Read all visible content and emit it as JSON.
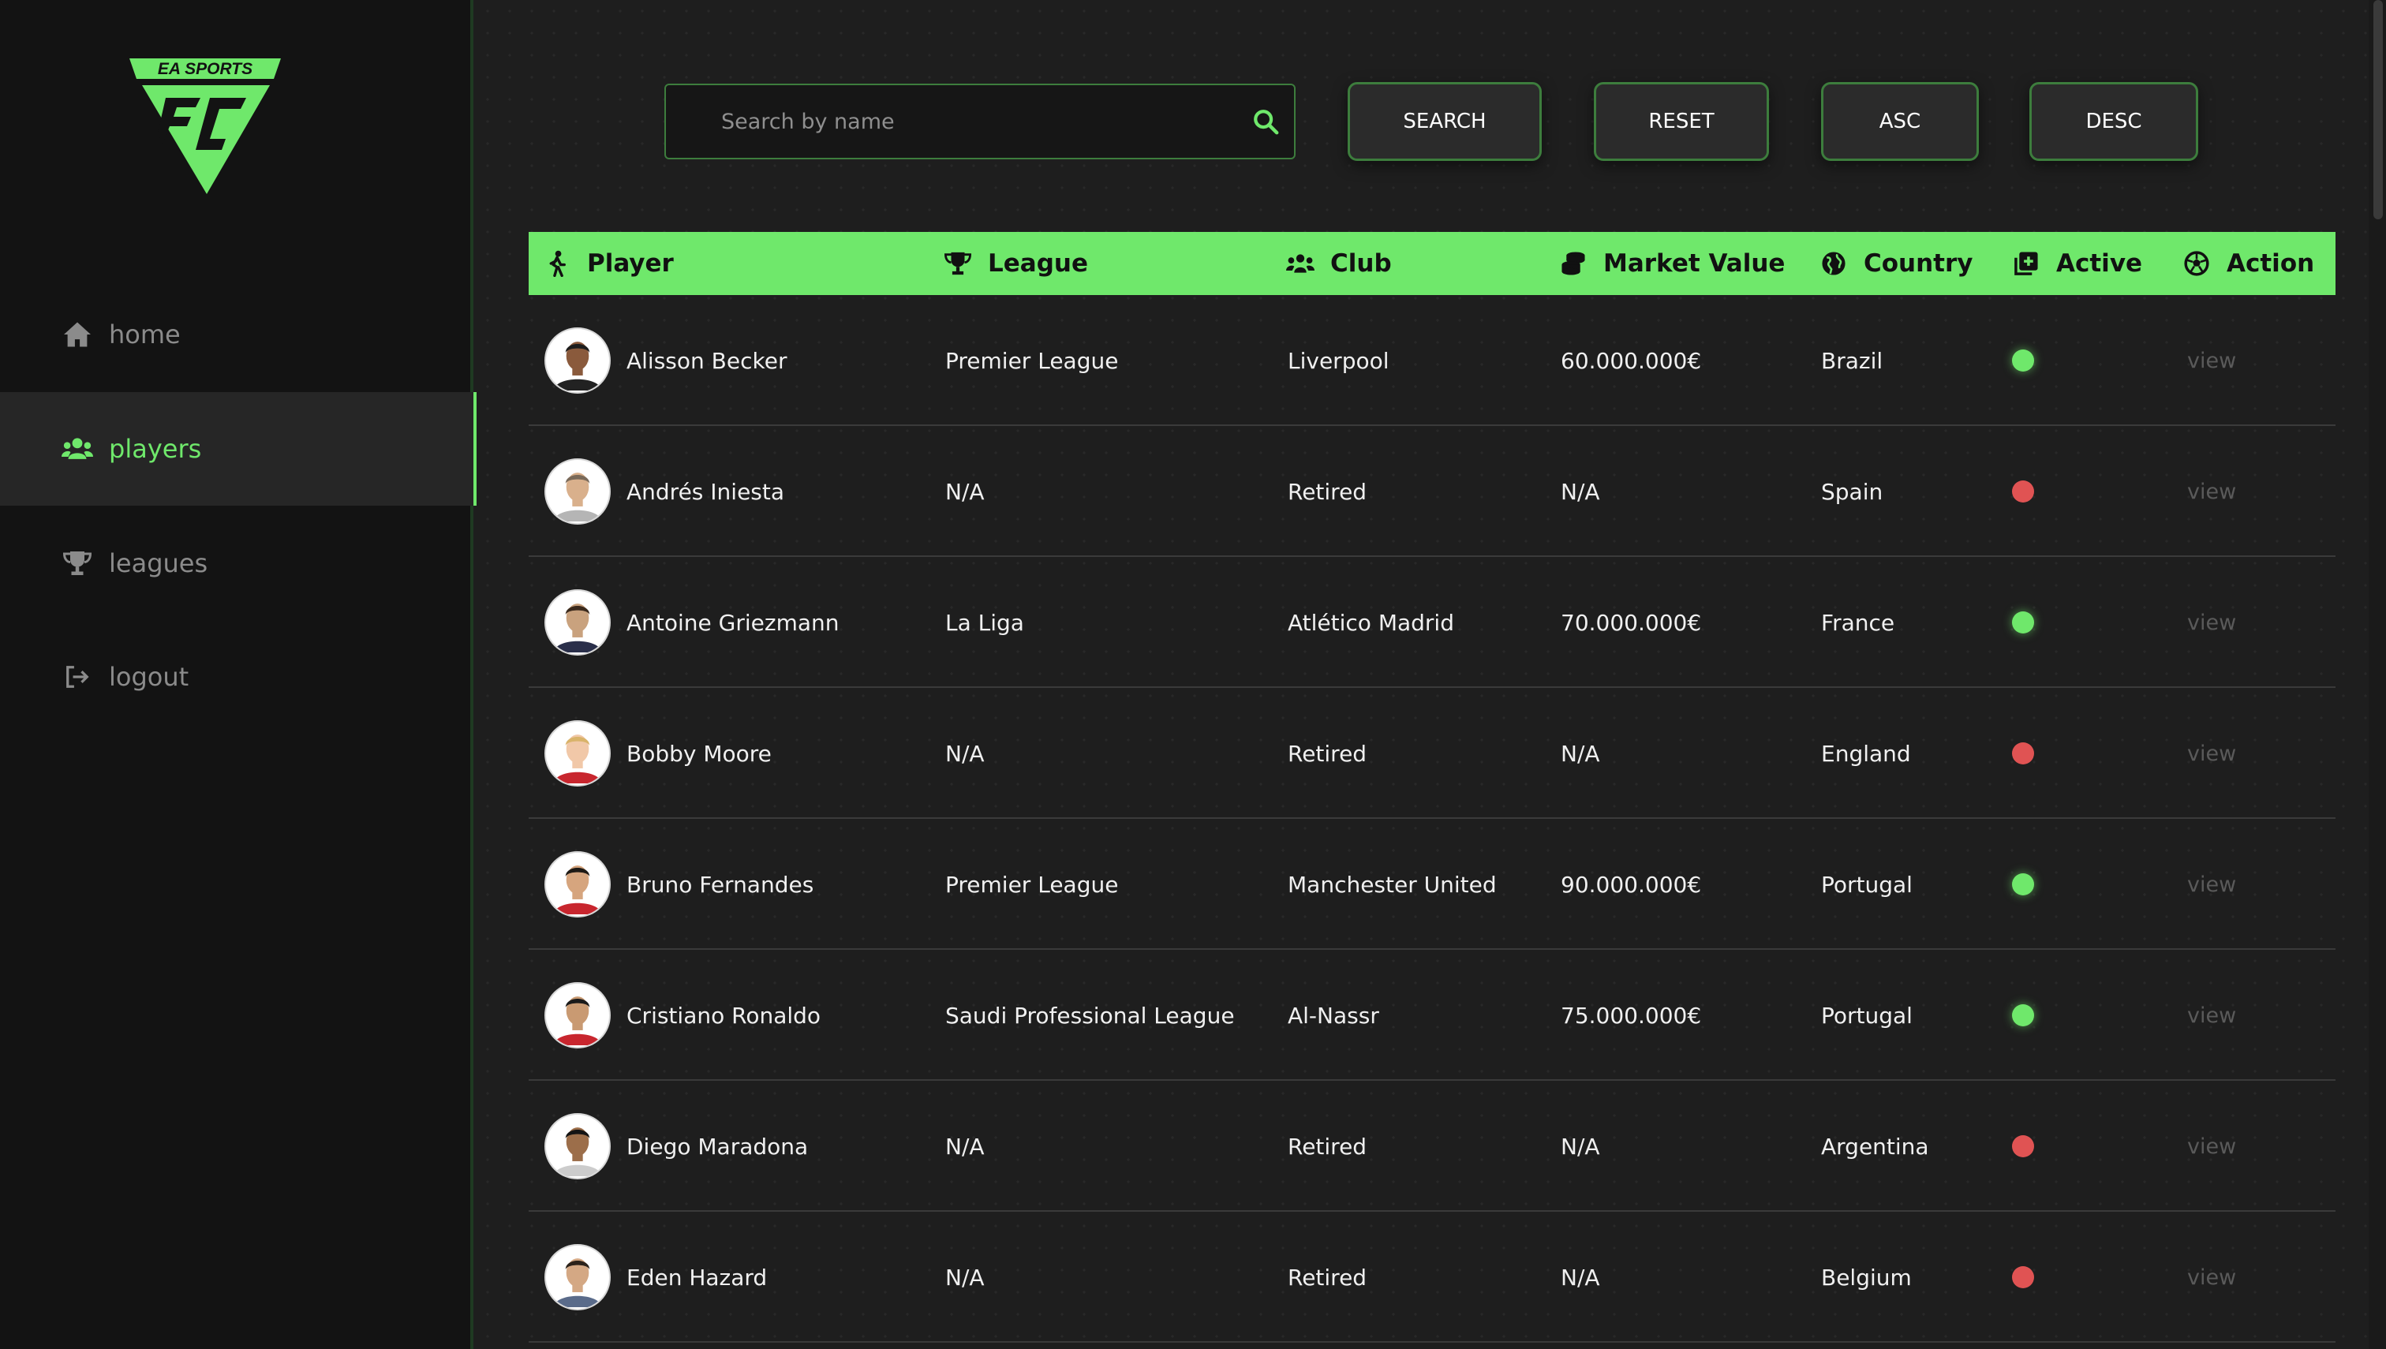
{
  "brand": {
    "logo_text": "EA SPORTS",
    "logo_mark": "FC"
  },
  "sidebar": {
    "items": [
      {
        "label": "home",
        "icon": "home-icon",
        "active": false
      },
      {
        "label": "players",
        "icon": "users-icon",
        "active": true
      },
      {
        "label": "leagues",
        "icon": "trophy-icon",
        "active": false
      },
      {
        "label": "logout",
        "icon": "logout-icon",
        "active": false
      }
    ]
  },
  "toolbar": {
    "search_placeholder": "Search by name",
    "search_value": "",
    "search_label": "SEARCH",
    "reset_label": "RESET",
    "asc_label": "ASC",
    "desc_label": "DESC"
  },
  "table": {
    "columns": [
      {
        "label": "Player",
        "icon": "running-person-icon"
      },
      {
        "label": "League",
        "icon": "trophy-icon"
      },
      {
        "label": "Club",
        "icon": "people-group-icon"
      },
      {
        "label": "Market Value",
        "icon": "coins-icon"
      },
      {
        "label": "Country",
        "icon": "globe-icon"
      },
      {
        "label": "Active",
        "icon": "square-plus-icon"
      },
      {
        "label": "Action",
        "icon": "soccer-ball-icon"
      }
    ],
    "rows": [
      {
        "player": "Alisson Becker",
        "league": "Premier League",
        "club": "Liverpool",
        "market_value": "60.000.000€",
        "country": "Brazil",
        "active": true,
        "action": "view"
      },
      {
        "player": "Andrés Iniesta",
        "league": "N/A",
        "club": "Retired",
        "market_value": "N/A",
        "country": "Spain",
        "active": false,
        "action": "view"
      },
      {
        "player": "Antoine Griezmann",
        "league": "La Liga",
        "club": "Atlético Madrid",
        "market_value": "70.000.000€",
        "country": "France",
        "active": true,
        "action": "view"
      },
      {
        "player": "Bobby Moore",
        "league": "N/A",
        "club": "Retired",
        "market_value": "N/A",
        "country": "England",
        "active": false,
        "action": "view"
      },
      {
        "player": "Bruno Fernandes",
        "league": "Premier League",
        "club": "Manchester United",
        "market_value": "90.000.000€",
        "country": "Portugal",
        "active": true,
        "action": "view"
      },
      {
        "player": "Cristiano Ronaldo",
        "league": "Saudi Professional League",
        "club": "Al-Nassr",
        "market_value": "75.000.000€",
        "country": "Portugal",
        "active": true,
        "action": "view"
      },
      {
        "player": "Diego Maradona",
        "league": "N/A",
        "club": "Retired",
        "market_value": "N/A",
        "country": "Argentina",
        "active": false,
        "action": "view"
      },
      {
        "player": "Eden Hazard",
        "league": "N/A",
        "club": "Retired",
        "market_value": "N/A",
        "country": "Belgium",
        "active": false,
        "action": "view"
      }
    ]
  },
  "colors": {
    "accent": "#6fe86b",
    "sidebar_bg": "#131313",
    "main_bg": "#1e1e1e",
    "active_dot": "#6fe86b",
    "inactive_dot": "#e05353"
  }
}
